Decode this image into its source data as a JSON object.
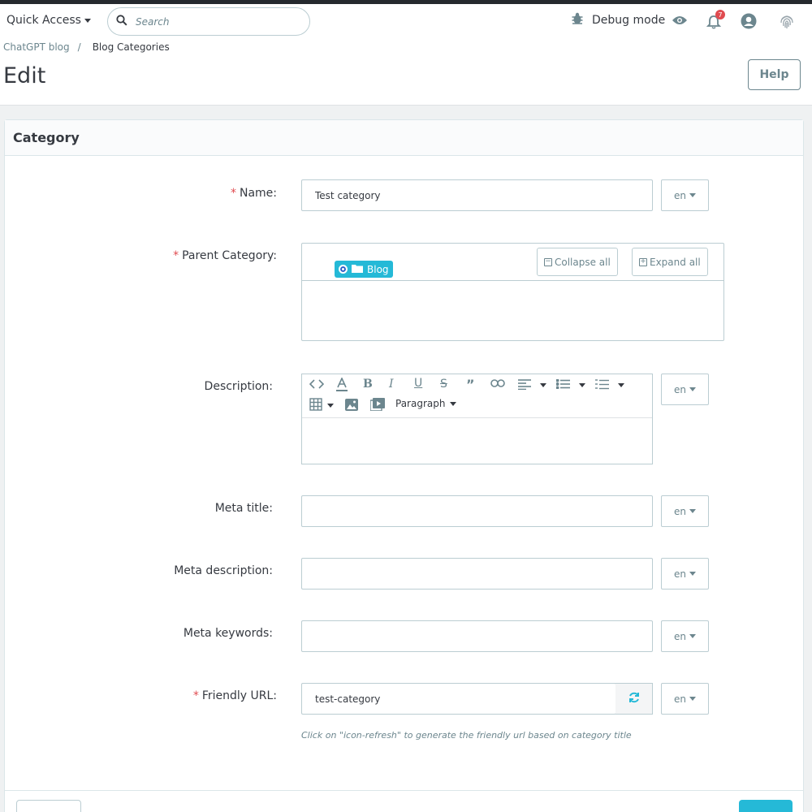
{
  "topbar": {
    "quick_access": "Quick Access",
    "search_placeholder": "Search",
    "debug_mode": "Debug mode",
    "notifications_count": "7"
  },
  "breadcrumb": {
    "parent": "ChatGPT blog",
    "separator": "/",
    "current": "Blog Categories"
  },
  "page_title": "Edit",
  "help_label": "Help",
  "card_title": "Category",
  "required_mark": "*",
  "form": {
    "name": {
      "label": "Name:",
      "value": "Test category",
      "lang": "en"
    },
    "parent": {
      "label": "Parent Category:",
      "collapse_all": "Collapse all",
      "expand_all": "Expand all",
      "tree_item": "Blog"
    },
    "description": {
      "label": "Description:",
      "lang": "en",
      "paragraph_label": "Paragraph"
    },
    "meta_title": {
      "label": "Meta title:",
      "value": "",
      "lang": "en"
    },
    "meta_description": {
      "label": "Meta description:",
      "value": "",
      "lang": "en"
    },
    "meta_keywords": {
      "label": "Meta keywords:",
      "value": "",
      "lang": "en"
    },
    "friendly_url": {
      "label": "Friendly URL:",
      "value": "test-category",
      "lang": "en",
      "hint": "Click on \"icon-refresh\" to generate the friendly url based on category title"
    }
  },
  "colors": {
    "accent": "#25b9d7",
    "required": "#e04b50",
    "muted": "#6c868e"
  },
  "icons": [
    "search-icon",
    "bug-icon",
    "eye-icon",
    "bell-icon",
    "user-icon",
    "fingerprint-icon",
    "folder-icon",
    "refresh-icon"
  ]
}
